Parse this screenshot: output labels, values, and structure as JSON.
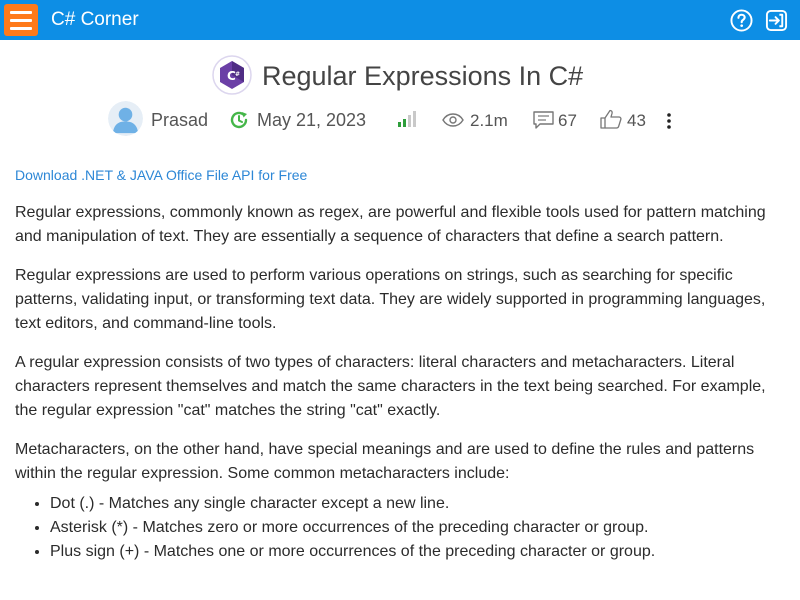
{
  "header": {
    "brand": "C# Corner",
    "menu_icon": "hamburger-menu-icon",
    "help_icon": "question-icon",
    "login_icon": "sign-in-icon",
    "bar_color": "#0d8ee5",
    "menu_color": "#ff7a1a"
  },
  "article": {
    "logo_icon": "csharp-logo-icon",
    "title": "Regular Expressions In C#",
    "author": "Prasad",
    "date": "May 21, 2023",
    "views": "2.1m",
    "comments": "67",
    "likes": "43",
    "difficulty_icon": "level-bars-icon"
  },
  "promo": {
    "link_text": "Download .NET & JAVA Office File API for Free"
  },
  "content": {
    "paragraphs": [
      "Regular expressions, commonly known as regex, are powerful and flexible tools used for pattern matching and manipulation of text. They are essentially a sequence of characters that define a search pattern.",
      "Regular expressions are used to perform various operations on strings, such as searching for specific patterns, validating input, or transforming text data. They are widely supported in programming languages, text editors, and command-line tools.",
      "A regular expression consists of two types of characters: literal characters and metacharacters. Literal characters represent themselves and match the same characters in the text being searched. For example, the regular expression \"cat\" matches the string \"cat\" exactly.",
      "Metacharacters, on the other hand, have special meanings and are used to define the rules and patterns within the regular expression. Some common metacharacters include:"
    ],
    "list": [
      "Dot (.) - Matches any single character except a new line.",
      "Asterisk (*) - Matches zero or more occurrences of the preceding character or group.",
      "Plus sign (+) - Matches one or more occurrences of the preceding character or group."
    ]
  }
}
